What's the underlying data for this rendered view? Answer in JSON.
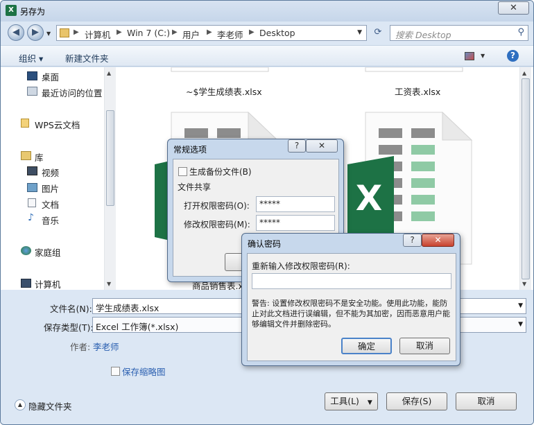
{
  "window": {
    "title": "另存为",
    "close_glyph": "✕"
  },
  "nav": {
    "back_glyph": "◀",
    "forward_glyph": "▶",
    "breadcrumb": [
      "计算机",
      "Win 7 (C:)",
      "用户",
      "李老师",
      "Desktop"
    ],
    "search_placeholder": "搜索 Desktop"
  },
  "toolbar": {
    "organize_label": "组织 ▾",
    "new_folder_label": "新建文件夹",
    "help_glyph": "?"
  },
  "sidebar": {
    "items": [
      {
        "label": "桌面",
        "icon": "desktop-icon"
      },
      {
        "label": "最近访问的位置",
        "icon": "recent-places-icon"
      },
      {
        "label": "WPS云文档",
        "icon": "folder-icon"
      },
      {
        "label": "库",
        "icon": "library-icon"
      },
      {
        "label": "视频",
        "icon": "video-icon"
      },
      {
        "label": "图片",
        "icon": "picture-icon"
      },
      {
        "label": "文档",
        "icon": "document-icon"
      },
      {
        "label": "音乐",
        "icon": "music-icon"
      },
      {
        "label": "家庭组",
        "icon": "homegroup-icon"
      },
      {
        "label": "计算机",
        "icon": "computer-icon"
      }
    ]
  },
  "files": {
    "items": [
      {
        "name": "~$学生成绩表.xlsx"
      },
      {
        "name": "工资表.xlsx"
      },
      {
        "name": "商品销售表.xl"
      }
    ],
    "excel_glyph": "X"
  },
  "form": {
    "filename_label": "文件名(N):",
    "filename_value": "学生成绩表.xlsx",
    "filetype_label": "保存类型(T):",
    "filetype_value": "Excel 工作簿(*.xlsx)",
    "author_label": "作者:",
    "author_value": "李老师",
    "thumbnail_label": "保存缩略图",
    "hide_folders_label": "隐藏文件夹",
    "tools_label": "工具(L)",
    "save_label": "保存(S)",
    "cancel_label": "取消"
  },
  "general_options": {
    "title": "常规选项",
    "help_glyph": "?",
    "close_glyph": "✕",
    "backup_label": "生成备份文件(B)",
    "section_label": "文件共享",
    "open_pwd_label": "打开权限密码(O):",
    "open_pwd_value": "*****",
    "modify_pwd_label": "修改权限密码(M):",
    "modify_pwd_value": "*****"
  },
  "confirm_password": {
    "title": "确认密码",
    "help_glyph": "?",
    "close_glyph": "✕",
    "prompt": "重新输入修改权限密码(R):",
    "input_value": "",
    "warning": "警告: 设置修改权限密码不是安全功能。使用此功能，能防止对此文档进行误编辑，但不能为其加密，因而恶意用户能够编辑文件并删除密码。",
    "ok_label": "确定",
    "cancel_label": "取消"
  }
}
